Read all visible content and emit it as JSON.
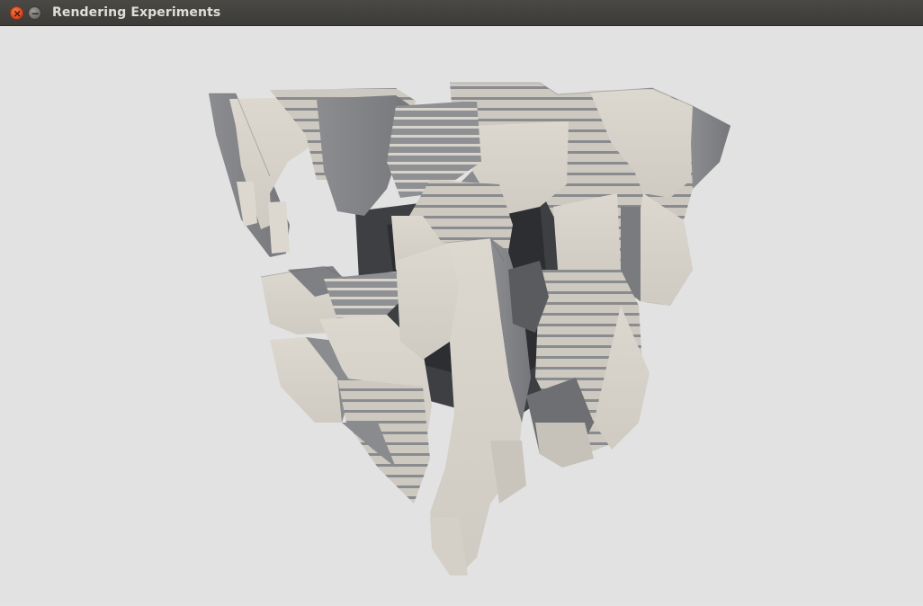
{
  "window": {
    "title": "Rendering Experiments",
    "controls": [
      "close-icon",
      "minimize-icon"
    ],
    "colors": {
      "titlebar": "#3c3b37",
      "close": "#e05a2b",
      "background": "#e2e2e2"
    }
  },
  "scene": {
    "description_icon": "voxel-cube-render"
  }
}
